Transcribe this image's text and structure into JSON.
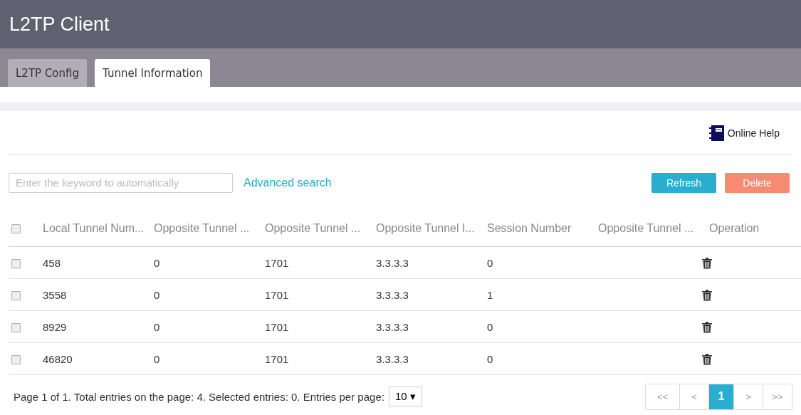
{
  "header": {
    "title": "L2TP Client"
  },
  "tabs": [
    {
      "label": "L2TP Config",
      "selected": false
    },
    {
      "label": "Tunnel Information",
      "selected": true
    }
  ],
  "help_link": "Online Help",
  "search": {
    "placeholder": "Enter the keyword to automatically"
  },
  "advanced_search": "Advanced search",
  "buttons": [
    {
      "label": "Refresh",
      "kind": "refresh"
    },
    {
      "label": "Delete",
      "kind": "delete"
    }
  ],
  "table": {
    "select_all_checked": false,
    "columns": [
      "Local Tunnel Num...",
      "Opposite Tunnel ...",
      "Opposite Tunnel ...",
      "Opposite Tunnel I...",
      "Session Number",
      "Opposite Tunnel ...",
      "Operation"
    ],
    "rows": [
      {
        "checked": false,
        "cells": [
          "458",
          "0",
          "1701",
          "3.3.3.3",
          "0",
          ""
        ]
      },
      {
        "checked": false,
        "cells": [
          "3558",
          "0",
          "1701",
          "3.3.3.3",
          "1",
          ""
        ]
      },
      {
        "checked": false,
        "cells": [
          "8929",
          "0",
          "1701",
          "3.3.3.3",
          "0",
          ""
        ]
      },
      {
        "checked": false,
        "cells": [
          "46820",
          "0",
          "1701",
          "3.3.3.3",
          "0",
          ""
        ]
      }
    ]
  },
  "footer": {
    "summary": "Page 1 of 1. Total entries on the page: 4. Selected entries: 0. Entries per page:",
    "per_page": "10 ▾",
    "pages": [
      {
        "label": "<<",
        "selected": false
      },
      {
        "label": "<",
        "selected": false
      },
      {
        "label": "1",
        "selected": true
      },
      {
        "label": ">",
        "selected": false
      },
      {
        "label": ">>",
        "selected": false
      }
    ]
  }
}
